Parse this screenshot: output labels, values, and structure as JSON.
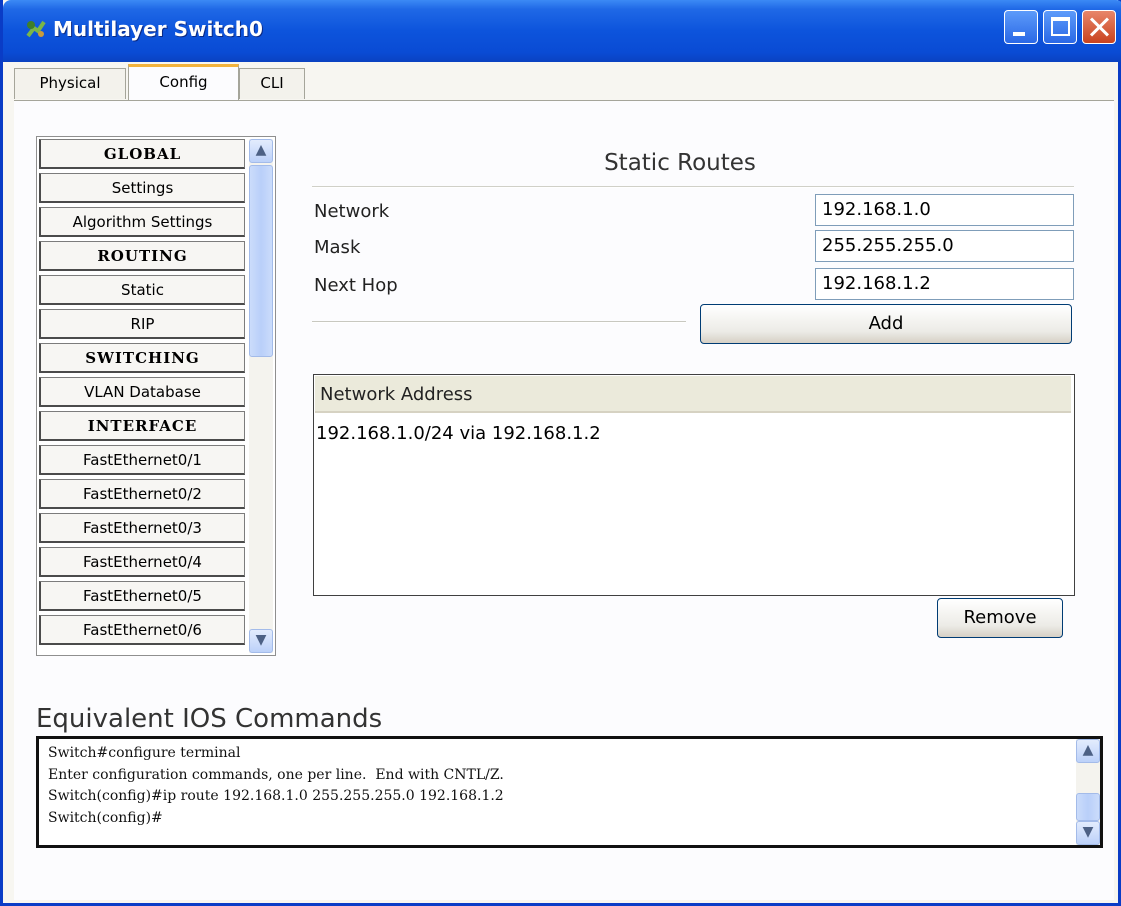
{
  "window": {
    "title": "Multilayer Switch0",
    "titlebar_color": "#0a4bd4"
  },
  "tabs": [
    {
      "label": "Physical",
      "active": false
    },
    {
      "label": "Config",
      "active": true
    },
    {
      "label": "CLI",
      "active": false
    }
  ],
  "nav": {
    "items": [
      {
        "label": "GLOBAL",
        "header": true
      },
      {
        "label": "Settings",
        "header": false
      },
      {
        "label": "Algorithm Settings",
        "header": false
      },
      {
        "label": "ROUTING",
        "header": true
      },
      {
        "label": "Static",
        "header": false
      },
      {
        "label": "RIP",
        "header": false
      },
      {
        "label": "SWITCHING",
        "header": true
      },
      {
        "label": "VLAN Database",
        "header": false
      },
      {
        "label": "INTERFACE",
        "header": true
      },
      {
        "label": "FastEthernet0/1",
        "header": false
      },
      {
        "label": "FastEthernet0/2",
        "header": false
      },
      {
        "label": "FastEthernet0/3",
        "header": false
      },
      {
        "label": "FastEthernet0/4",
        "header": false
      },
      {
        "label": "FastEthernet0/5",
        "header": false
      },
      {
        "label": "FastEthernet0/6",
        "header": false
      }
    ]
  },
  "static_routes": {
    "title": "Static Routes",
    "network_label": "Network",
    "network_value": "192.168.1.0",
    "mask_label": "Mask",
    "mask_value": "255.255.255.0",
    "next_hop_label": "Next Hop",
    "next_hop_value": "192.168.1.2",
    "add_label": "Add",
    "list_header": "Network Address",
    "routes": [
      "192.168.1.0/24 via 192.168.1.2"
    ],
    "remove_label": "Remove"
  },
  "ios": {
    "title": "Equivalent IOS Commands",
    "lines": [
      "Switch#configure terminal",
      "Enter configuration commands, one per line.  End with CNTL/Z.",
      "Switch(config)#ip route 192.168.1.0 255.255.255.0 192.168.1.2",
      "Switch(config)#"
    ]
  }
}
